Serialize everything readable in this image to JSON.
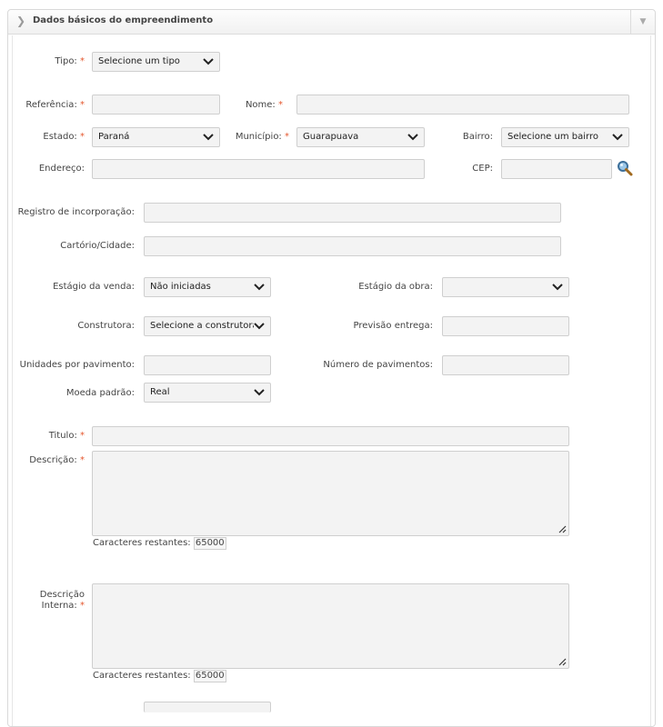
{
  "panel": {
    "title": "Dados básicos do empreendimento",
    "collapse_glyph": "❯",
    "toggle_glyph": "▼"
  },
  "form": {
    "required_mark": "*",
    "tipo": {
      "label": "Tipo:",
      "value": "Selecione um tipo"
    },
    "referencia": {
      "label": "Referência:",
      "value": ""
    },
    "nome": {
      "label": "Nome:",
      "value": ""
    },
    "estado": {
      "label": "Estado:",
      "value": "Paraná"
    },
    "municipio": {
      "label": "Município:",
      "value": "Guarapuava"
    },
    "bairro": {
      "label": "Bairro:",
      "value": "Selecione um bairro"
    },
    "endereco": {
      "label": "Endereço:",
      "value": ""
    },
    "cep": {
      "label": "CEP:",
      "value": "",
      "icon": "search-icon"
    },
    "registro": {
      "label": "Registro de incorporação:",
      "value": ""
    },
    "cartorio": {
      "label": "Cartório/Cidade:",
      "value": ""
    },
    "estagio_venda": {
      "label": "Estágio da venda:",
      "value": "Não iniciadas"
    },
    "estagio_obra": {
      "label": "Estágio da obra:",
      "value": ""
    },
    "construtora": {
      "label": "Construtora:",
      "value": "Selecione a construtora"
    },
    "previsao": {
      "label": "Previsão entrega:",
      "value": ""
    },
    "unidades": {
      "label": "Unidades por pavimento:",
      "value": ""
    },
    "num_pavimentos": {
      "label": "Número de pavimentos:",
      "value": ""
    },
    "moeda": {
      "label": "Moeda padrão:",
      "value": "Real"
    },
    "titulo": {
      "label": "Titulo:",
      "value": ""
    },
    "descricao": {
      "label": "Descrição:",
      "value": "",
      "remaining_label": "Caracteres restantes:",
      "remaining": "65000"
    },
    "descricao_interna": {
      "label_line1": "Descrição",
      "label_line2": "Interna:",
      "value": "",
      "remaining_label": "Caracteres restantes:",
      "remaining": "65000"
    }
  },
  "colors": {
    "required": "#e4572e",
    "field_bg": "#f3f3f3",
    "border": "#cfcfcf"
  }
}
